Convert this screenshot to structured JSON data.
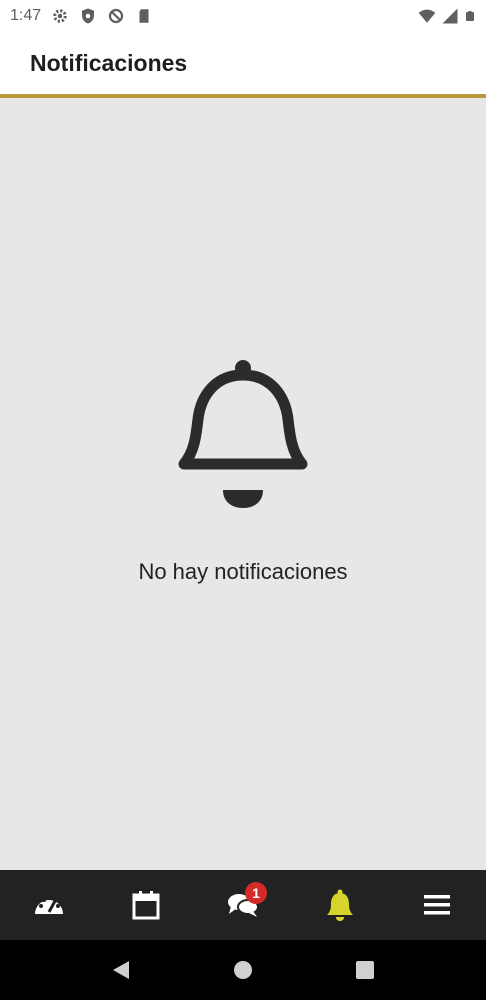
{
  "status_bar": {
    "time": "1:47",
    "icons": [
      "gear-icon",
      "shield-icon",
      "no-sign-icon",
      "sd-card-icon",
      "wifi-icon",
      "signal-icon",
      "battery-icon"
    ]
  },
  "app_bar": {
    "title": "Notificaciones",
    "accent_color": "#b89a3c"
  },
  "empty_state": {
    "icon": "bell-icon",
    "message": "No hay notificaciones"
  },
  "bottom_nav": {
    "items": [
      {
        "icon": "dashboard-icon"
      },
      {
        "icon": "calendar-icon"
      },
      {
        "icon": "chat-icon",
        "badge": "1"
      },
      {
        "icon": "bell-icon",
        "active": true,
        "active_color": "#d6d32a"
      },
      {
        "icon": "menu-icon"
      }
    ]
  },
  "system_nav": {
    "items": [
      "back-icon",
      "home-icon",
      "recents-icon"
    ]
  }
}
